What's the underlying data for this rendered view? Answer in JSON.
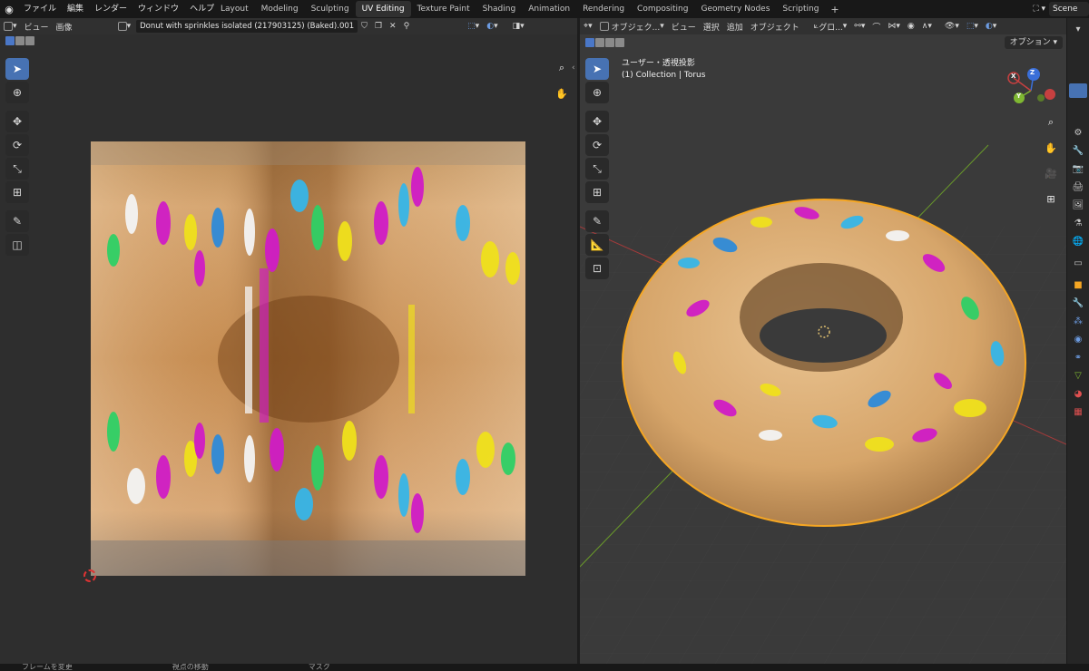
{
  "menubar": {
    "items": [
      "ファイル",
      "編集",
      "レンダー",
      "ウィンドウ",
      "ヘルプ"
    ]
  },
  "workspaces": {
    "tabs": [
      "Layout",
      "Modeling",
      "Sculpting",
      "UV Editing",
      "Texture Paint",
      "Shading",
      "Animation",
      "Rendering",
      "Compositing",
      "Geometry Nodes",
      "Scripting"
    ],
    "active": "UV Editing",
    "add": "+"
  },
  "scene": {
    "name": "Scene"
  },
  "uv_editor": {
    "menu": [
      "ビュー",
      "画像"
    ],
    "image_name": "Donut with sprinkles isolated (217903125) (Baked).001"
  },
  "viewport": {
    "menu": [
      "オブジェク...",
      "ビュー",
      "選択",
      "追加",
      "オブジェクト"
    ],
    "orientation": "グロ...",
    "options_label": "オプション",
    "view_label": "ユーザー・透視投影",
    "collection_label": "(1) Collection | Torus",
    "gizmo": {
      "x": "X",
      "y": "Y",
      "z": "Z"
    }
  },
  "statusbar": {
    "items": [
      "フレームを変更",
      "視点の移動",
      "マスク"
    ]
  },
  "colors": {
    "accent": "#4772b3",
    "selection_outline": "#f5a623",
    "axis_x": "#c74040",
    "axis_y": "#7fb832"
  }
}
